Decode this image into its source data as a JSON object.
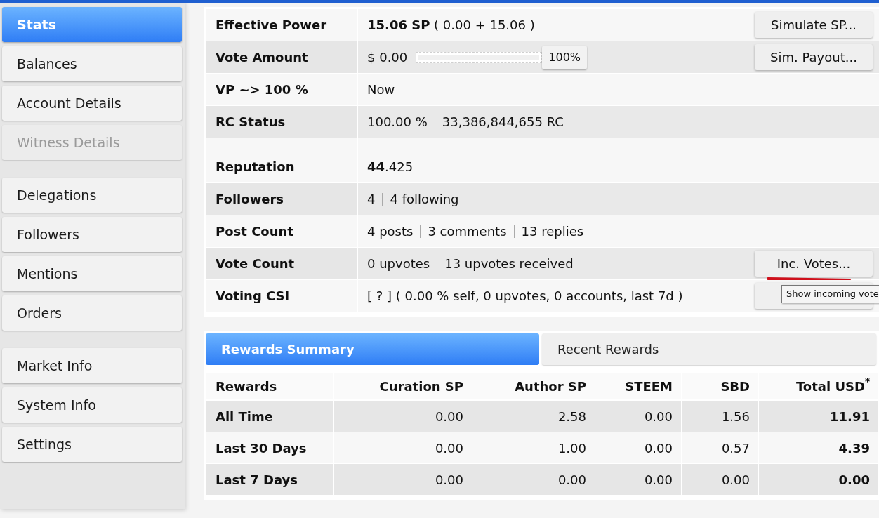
{
  "sidebar": {
    "groups": [
      [
        {
          "label": "Stats",
          "selected": true,
          "disabled": false
        },
        {
          "label": "Balances",
          "selected": false,
          "disabled": false
        },
        {
          "label": "Account Details",
          "selected": false,
          "disabled": false
        },
        {
          "label": "Witness Details",
          "selected": false,
          "disabled": true
        }
      ],
      [
        {
          "label": "Delegations",
          "selected": false,
          "disabled": false
        },
        {
          "label": "Followers",
          "selected": false,
          "disabled": false
        },
        {
          "label": "Mentions",
          "selected": false,
          "disabled": false
        },
        {
          "label": "Orders",
          "selected": false,
          "disabled": false
        }
      ],
      [
        {
          "label": "Market Info",
          "selected": false,
          "disabled": false
        },
        {
          "label": "System Info",
          "selected": false,
          "disabled": false
        },
        {
          "label": "Settings",
          "selected": false,
          "disabled": false
        }
      ]
    ]
  },
  "stats": {
    "groups": [
      [
        {
          "label": "Effective Power",
          "value": "**15.06 SP** ( 0.00 + 15.06 )",
          "button": "Simulate SP..."
        },
        {
          "label": "Vote Amount",
          "kind": "slider",
          "value": "$ 0.00",
          "level": 1,
          "reading": "100%",
          "button": "Sim. Payout..."
        },
        {
          "label": "VP ~> 100 %",
          "value": "Now"
        },
        {
          "label": "RC Status",
          "parts": [
            "100.00 %",
            "33,386,844,655 RC"
          ]
        }
      ],
      [
        {
          "label": "Reputation",
          "value": "**44**.425"
        },
        {
          "label": "Followers",
          "parts": [
            "4",
            "4 following"
          ]
        },
        {
          "label": "Post Count",
          "parts": [
            "4 posts",
            "3 comments",
            "13 replies"
          ]
        },
        {
          "label": "Vote Count",
          "parts": [
            "0 upvotes",
            "13 upvotes received"
          ],
          "button": "Inc. Votes...",
          "annotated": true
        },
        {
          "label": "Voting CSI",
          "value": "[ ? ] ( 0.00 % self, 0 upvotes, 0 accounts, last 7d )",
          "covered_button": true
        }
      ]
    ],
    "tooltip": "Show incoming vote"
  },
  "rewards": {
    "tabs": [
      {
        "label": "Rewards Summary",
        "selected": true
      },
      {
        "label": "Recent Rewards",
        "selected": false
      }
    ],
    "columns": [
      "Rewards",
      "Curation SP",
      "Author SP",
      "STEEM",
      "SBD",
      "Total USD$^{*}$"
    ],
    "rows": [
      [
        "All Time",
        "0.00",
        "2.58",
        "0.00",
        "1.56",
        "11.91"
      ],
      [
        "Last 30 Days",
        "0.00",
        "1.00",
        "0.00",
        "0.57",
        "4.39"
      ],
      [
        "Last 7 Days",
        "0.00",
        "0.00",
        "0.00",
        "0.00",
        "0.00"
      ]
    ]
  }
}
